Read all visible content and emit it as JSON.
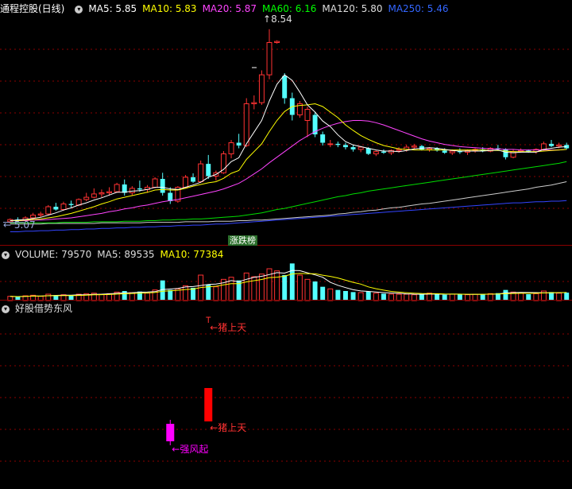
{
  "main_panel": {
    "title": "通程控股(日线)",
    "indicators": [
      {
        "label": "MA5: 5.85",
        "color": "#ffffff"
      },
      {
        "label": "MA10: 5.83",
        "color": "#ffff00"
      },
      {
        "label": "MA20: 5.87",
        "color": "#ff44ff"
      },
      {
        "label": "MA60: 6.16",
        "color": "#00ff00"
      },
      {
        "label": "MA120: 5.80",
        "color": "#dddddd"
      },
      {
        "label": "MA250: 5.46",
        "color": "#3366ff"
      }
    ],
    "high_label": "8.54",
    "low_label": "← 5.07",
    "badge": "涨跌榜"
  },
  "volume_panel": {
    "indicators": [
      {
        "label": "VOLUME: 79570",
        "color": "#dddddd"
      },
      {
        "label": "MA5: 89535",
        "color": "#dddddd"
      },
      {
        "label": "MA10: 77384",
        "color": "#ffff00"
      }
    ]
  },
  "signal_panel": {
    "title": "好股借势东风",
    "top_label": "←猪上天",
    "red_label": "←猪上天",
    "magenta_label": "←强风起"
  },
  "colors": {
    "up": "#ff3232",
    "down": "#54ffff",
    "grid": "#8b0000"
  },
  "chart_data": {
    "type": "candlestick",
    "candles": [
      [
        5.08,
        5.14,
        5.05,
        5.12
      ],
      [
        5.12,
        5.16,
        5.09,
        5.1
      ],
      [
        5.1,
        5.18,
        5.08,
        5.15
      ],
      [
        5.15,
        5.24,
        5.12,
        5.2
      ],
      [
        5.2,
        5.26,
        5.16,
        5.22
      ],
      [
        5.22,
        5.38,
        5.2,
        5.35
      ],
      [
        5.35,
        5.42,
        5.28,
        5.3
      ],
      [
        5.3,
        5.44,
        5.28,
        5.4
      ],
      [
        5.4,
        5.46,
        5.34,
        5.38
      ],
      [
        5.38,
        5.5,
        5.36,
        5.48
      ],
      [
        5.48,
        5.6,
        5.45,
        5.52
      ],
      [
        5.52,
        5.68,
        5.5,
        5.58
      ],
      [
        5.58,
        5.66,
        5.52,
        5.6
      ],
      [
        5.6,
        5.7,
        5.55,
        5.62
      ],
      [
        5.62,
        5.78,
        5.6,
        5.75
      ],
      [
        5.75,
        5.84,
        5.55,
        5.6
      ],
      [
        5.6,
        5.72,
        5.55,
        5.68
      ],
      [
        5.68,
        5.82,
        5.62,
        5.66
      ],
      [
        5.66,
        5.74,
        5.6,
        5.7
      ],
      [
        5.7,
        5.88,
        5.68,
        5.85
      ],
      [
        5.85,
        5.96,
        5.55,
        5.6
      ],
      [
        5.6,
        5.7,
        5.4,
        5.45
      ],
      [
        5.45,
        5.72,
        5.42,
        5.7
      ],
      [
        5.7,
        5.92,
        5.68,
        5.88
      ],
      [
        5.88,
        5.95,
        5.78,
        5.8
      ],
      [
        5.8,
        6.18,
        5.78,
        6.12
      ],
      [
        6.12,
        6.28,
        5.85,
        5.9
      ],
      [
        5.9,
        6.0,
        5.82,
        5.96
      ],
      [
        5.96,
        6.35,
        5.94,
        6.3
      ],
      [
        6.3,
        6.55,
        6.22,
        6.5
      ],
      [
        6.5,
        6.66,
        6.4,
        6.45
      ],
      [
        6.45,
        7.3,
        6.42,
        7.2
      ],
      [
        7.2,
        7.35,
        7.1,
        7.22
      ],
      [
        7.22,
        7.8,
        7.18,
        7.72
      ],
      [
        7.72,
        8.54,
        7.64,
        8.3
      ],
      [
        8.3,
        8.34,
        8.28,
        8.32
      ],
      [
        7.7,
        7.75,
        7.2,
        7.3
      ],
      [
        7.3,
        7.4,
        6.9,
        7.0
      ],
      [
        7.0,
        7.25,
        6.95,
        7.2
      ],
      [
        6.9,
        7.15,
        6.6,
        7.1
      ],
      [
        7.0,
        7.05,
        6.6,
        6.65
      ],
      [
        6.65,
        6.7,
        6.45,
        6.5
      ],
      [
        6.48,
        6.55,
        6.42,
        6.48
      ],
      [
        6.48,
        6.52,
        6.42,
        6.46
      ],
      [
        6.46,
        6.5,
        6.38,
        6.42
      ],
      [
        6.42,
        6.46,
        6.34,
        6.38
      ],
      [
        6.38,
        6.44,
        6.33,
        6.42
      ],
      [
        6.4,
        6.42,
        6.28,
        6.3
      ],
      [
        6.3,
        6.36,
        6.26,
        6.34
      ],
      [
        6.34,
        6.38,
        6.3,
        6.32
      ],
      [
        6.32,
        6.38,
        6.28,
        6.36
      ],
      [
        6.36,
        6.42,
        6.32,
        6.38
      ],
      [
        6.38,
        6.46,
        6.34,
        6.42
      ],
      [
        6.42,
        6.48,
        6.38,
        6.44
      ],
      [
        6.44,
        6.46,
        6.36,
        6.38
      ],
      [
        6.38,
        6.42,
        6.34,
        6.4
      ],
      [
        6.4,
        6.42,
        6.34,
        6.36
      ],
      [
        6.36,
        6.4,
        6.3,
        6.32
      ],
      [
        6.32,
        6.38,
        6.28,
        6.35
      ],
      [
        6.35,
        6.4,
        6.3,
        6.33
      ],
      [
        6.33,
        6.38,
        6.28,
        6.36
      ],
      [
        6.36,
        6.4,
        6.32,
        6.38
      ],
      [
        6.38,
        6.42,
        6.33,
        6.35
      ],
      [
        6.35,
        6.42,
        6.33,
        6.4
      ],
      [
        6.4,
        6.46,
        6.36,
        6.38
      ],
      [
        6.38,
        6.4,
        6.2,
        6.24
      ],
      [
        6.24,
        6.38,
        6.22,
        6.34
      ],
      [
        6.34,
        6.4,
        6.32,
        6.36
      ],
      [
        6.36,
        6.38,
        6.32,
        6.34
      ],
      [
        6.34,
        6.4,
        6.3,
        6.38
      ],
      [
        6.38,
        6.52,
        6.36,
        6.48
      ],
      [
        6.48,
        6.55,
        6.42,
        6.44
      ],
      [
        6.44,
        6.5,
        6.4,
        6.46
      ],
      [
        6.46,
        6.5,
        6.38,
        6.4
      ]
    ],
    "volumes": [
      8,
      7,
      9,
      10,
      8,
      12,
      10,
      11,
      9,
      12,
      13,
      14,
      12,
      13,
      16,
      18,
      15,
      17,
      14,
      20,
      38,
      20,
      22,
      28,
      24,
      48,
      30,
      26,
      40,
      44,
      38,
      52,
      45,
      50,
      60,
      56,
      48,
      70,
      48,
      40,
      36,
      26,
      22,
      20,
      18,
      16,
      15,
      17,
      14,
      13,
      12,
      12,
      12,
      11,
      12,
      14,
      12,
      11,
      12,
      12,
      11,
      12,
      12,
      13,
      14,
      20,
      16,
      14,
      12,
      13,
      18,
      16,
      14,
      15
    ],
    "ma5": [
      5.1,
      5.11,
      5.12,
      5.14,
      5.16,
      5.2,
      5.24,
      5.29,
      5.33,
      5.38,
      5.42,
      5.47,
      5.51,
      5.56,
      5.61,
      5.61,
      5.63,
      5.64,
      5.66,
      5.7,
      5.7,
      5.67,
      5.66,
      5.7,
      5.74,
      5.79,
      5.88,
      5.93,
      6.02,
      6.16,
      6.23,
      6.48,
      6.69,
      6.9,
      7.25,
      7.55,
      7.72,
      7.62,
      7.41,
      7.18,
      7.05,
      6.89,
      6.79,
      6.64,
      6.52,
      6.46,
      6.43,
      6.4,
      6.37,
      6.35,
      6.35,
      6.34,
      6.36,
      6.39,
      6.4,
      6.41,
      6.4,
      6.38,
      6.36,
      6.35,
      6.35,
      6.35,
      6.35,
      6.36,
      6.37,
      6.33,
      6.32,
      6.33,
      6.33,
      6.33,
      6.38,
      6.4,
      6.42,
      6.43
    ],
    "ma10": [
      5.1,
      5.1,
      5.11,
      5.12,
      5.13,
      5.15,
      5.17,
      5.2,
      5.23,
      5.27,
      5.31,
      5.35,
      5.4,
      5.44,
      5.49,
      5.52,
      5.55,
      5.58,
      5.61,
      5.65,
      5.66,
      5.65,
      5.65,
      5.68,
      5.72,
      5.75,
      5.78,
      5.8,
      5.86,
      5.95,
      6.0,
      6.2,
      6.34,
      6.48,
      6.7,
      6.9,
      7.06,
      7.15,
      7.17,
      7.18,
      7.2,
      7.15,
      7.05,
      6.95,
      6.82,
      6.72,
      6.63,
      6.56,
      6.5,
      6.45,
      6.42,
      6.39,
      6.38,
      6.37,
      6.37,
      6.37,
      6.37,
      6.37,
      6.37,
      6.37,
      6.37,
      6.37,
      6.37,
      6.36,
      6.36,
      6.35,
      6.34,
      6.34,
      6.34,
      6.34,
      6.35,
      6.36,
      6.37,
      6.38
    ],
    "ma20": [
      5.1,
      5.1,
      5.1,
      5.11,
      5.11,
      5.12,
      5.13,
      5.14,
      5.15,
      5.17,
      5.19,
      5.21,
      5.23,
      5.26,
      5.28,
      5.31,
      5.33,
      5.36,
      5.38,
      5.41,
      5.44,
      5.46,
      5.48,
      5.51,
      5.54,
      5.57,
      5.6,
      5.63,
      5.67,
      5.72,
      5.77,
      5.85,
      5.94,
      6.03,
      6.14,
      6.24,
      6.34,
      6.44,
      6.54,
      6.62,
      6.7,
      6.76,
      6.81,
      6.85,
      6.88,
      6.9,
      6.9,
      6.89,
      6.86,
      6.82,
      6.77,
      6.72,
      6.67,
      6.62,
      6.57,
      6.53,
      6.5,
      6.47,
      6.45,
      6.43,
      6.42,
      6.41,
      6.4,
      6.39,
      6.39,
      6.38,
      6.38,
      6.37,
      6.37,
      6.37,
      6.37,
      6.37,
      6.37,
      6.38
    ],
    "ma60": [
      5.06,
      5.06,
      5.06,
      5.06,
      5.06,
      5.06,
      5.06,
      5.07,
      5.07,
      5.07,
      5.07,
      5.08,
      5.08,
      5.08,
      5.08,
      5.09,
      5.09,
      5.09,
      5.1,
      5.1,
      5.11,
      5.11,
      5.12,
      5.12,
      5.13,
      5.13,
      5.14,
      5.15,
      5.16,
      5.17,
      5.18,
      5.2,
      5.22,
      5.24,
      5.27,
      5.3,
      5.32,
      5.35,
      5.38,
      5.41,
      5.44,
      5.47,
      5.5,
      5.53,
      5.55,
      5.58,
      5.6,
      5.63,
      5.65,
      5.67,
      5.69,
      5.71,
      5.73,
      5.75,
      5.77,
      5.79,
      5.81,
      5.83,
      5.85,
      5.87,
      5.89,
      5.91,
      5.93,
      5.95,
      5.97,
      5.99,
      6.01,
      6.03,
      6.05,
      6.07,
      6.09,
      6.11,
      6.13,
      6.16
    ],
    "ma120": [
      5.04,
      5.04,
      5.04,
      5.04,
      5.04,
      5.05,
      5.05,
      5.05,
      5.05,
      5.05,
      5.05,
      5.05,
      5.06,
      5.06,
      5.06,
      5.06,
      5.06,
      5.06,
      5.07,
      5.07,
      5.07,
      5.07,
      5.07,
      5.08,
      5.08,
      5.08,
      5.08,
      5.09,
      5.09,
      5.09,
      5.1,
      5.1,
      5.11,
      5.11,
      5.12,
      5.13,
      5.14,
      5.15,
      5.16,
      5.17,
      5.18,
      5.19,
      5.2,
      5.22,
      5.23,
      5.25,
      5.26,
      5.28,
      5.29,
      5.31,
      5.33,
      5.34,
      5.36,
      5.38,
      5.4,
      5.41,
      5.43,
      5.45,
      5.47,
      5.49,
      5.51,
      5.53,
      5.55,
      5.57,
      5.59,
      5.61,
      5.63,
      5.65,
      5.67,
      5.7,
      5.72,
      5.74,
      5.77,
      5.8
    ],
    "ma250": [
      4.9,
      4.9,
      4.91,
      4.91,
      4.92,
      4.92,
      4.93,
      4.93,
      4.94,
      4.94,
      4.95,
      4.95,
      4.96,
      4.96,
      4.97,
      4.97,
      4.98,
      4.98,
      4.99,
      4.99,
      5.0,
      5.0,
      5.01,
      5.01,
      5.02,
      5.02,
      5.03,
      5.04,
      5.04,
      5.05,
      5.06,
      5.07,
      5.08,
      5.09,
      5.1,
      5.11,
      5.12,
      5.13,
      5.14,
      5.15,
      5.16,
      5.17,
      5.18,
      5.19,
      5.2,
      5.21,
      5.22,
      5.23,
      5.24,
      5.25,
      5.26,
      5.27,
      5.28,
      5.29,
      5.3,
      5.31,
      5.32,
      5.33,
      5.34,
      5.35,
      5.36,
      5.37,
      5.38,
      5.39,
      5.4,
      5.41,
      5.42,
      5.42,
      5.43,
      5.44,
      5.44,
      5.45,
      5.45,
      5.46
    ],
    "signal_bars": [
      {
        "index": 21,
        "label_ref": "magenta_label",
        "color": "#ff00ff"
      },
      {
        "index": 26,
        "label_ref": "red_label",
        "color": "#ff0000"
      }
    ],
    "price_range": [
      4.85,
      8.75
    ],
    "volume_range": [
      0,
      72
    ]
  }
}
